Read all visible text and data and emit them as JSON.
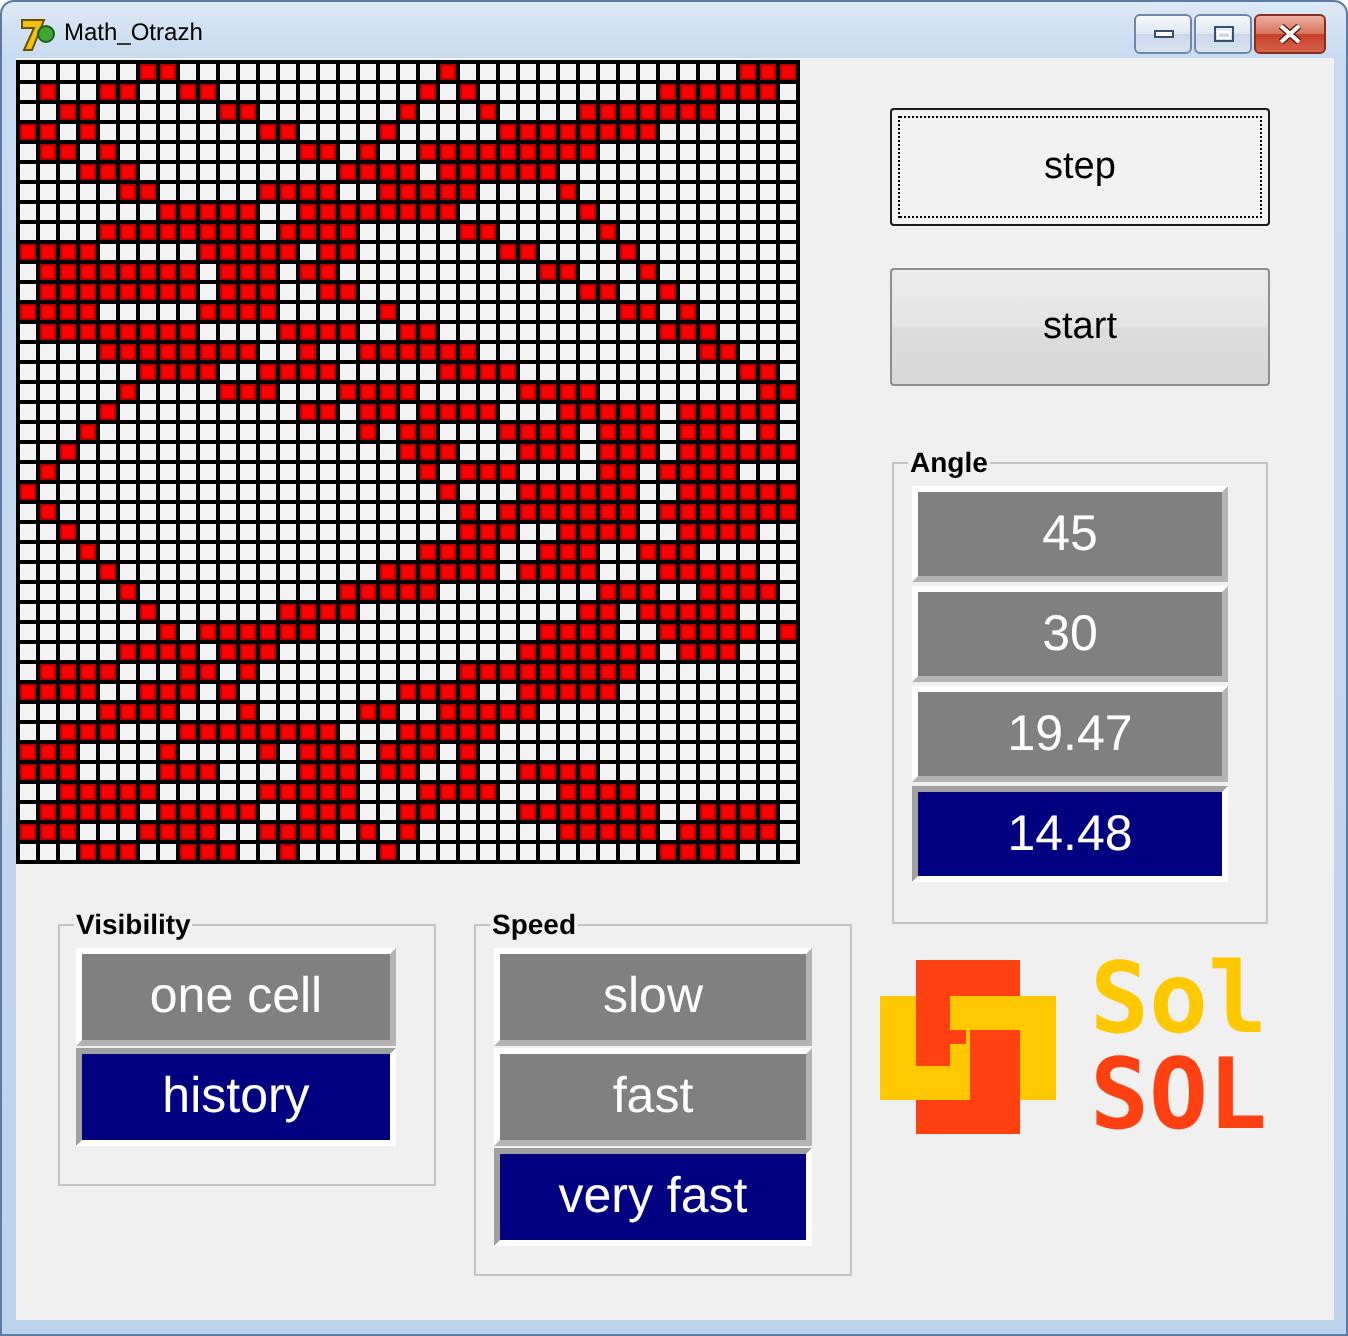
{
  "window": {
    "title": "Math_Otrazh"
  },
  "board": {
    "cells": [
      [
        false,
        false,
        false,
        false,
        false,
        false,
        true,
        true,
        false,
        false,
        false,
        false,
        false,
        false,
        false,
        false,
        false,
        false,
        false,
        false,
        false,
        true,
        false,
        false,
        false,
        false,
        false,
        false,
        false,
        false,
        false,
        false,
        false,
        false,
        false,
        false,
        true,
        true,
        true
      ],
      [
        false,
        true,
        false,
        false,
        true,
        true,
        false,
        false,
        true,
        true,
        false,
        false,
        false,
        false,
        false,
        false,
        false,
        false,
        false,
        false,
        true,
        false,
        true,
        false,
        false,
        false,
        false,
        false,
        false,
        false,
        false,
        false,
        true,
        true,
        true,
        true,
        true,
        true,
        false
      ],
      [
        false,
        false,
        true,
        true,
        false,
        false,
        false,
        false,
        false,
        false,
        true,
        true,
        false,
        false,
        false,
        false,
        false,
        false,
        false,
        true,
        false,
        false,
        false,
        true,
        false,
        false,
        false,
        false,
        true,
        true,
        true,
        true,
        true,
        true,
        true,
        false,
        false,
        false,
        false
      ],
      [
        true,
        true,
        false,
        true,
        false,
        false,
        false,
        false,
        false,
        false,
        false,
        false,
        true,
        true,
        false,
        false,
        false,
        false,
        true,
        false,
        false,
        false,
        false,
        false,
        true,
        true,
        true,
        true,
        true,
        true,
        true,
        true,
        false,
        false,
        false,
        false,
        false,
        false,
        false
      ],
      [
        false,
        true,
        true,
        false,
        true,
        false,
        false,
        false,
        false,
        false,
        false,
        false,
        false,
        false,
        true,
        true,
        false,
        true,
        false,
        false,
        true,
        true,
        true,
        true,
        true,
        true,
        true,
        true,
        true,
        false,
        false,
        false,
        false,
        false,
        false,
        false,
        false,
        false,
        false
      ],
      [
        false,
        false,
        false,
        true,
        true,
        true,
        false,
        false,
        false,
        false,
        false,
        false,
        false,
        false,
        false,
        false,
        true,
        true,
        true,
        true,
        false,
        true,
        true,
        true,
        true,
        true,
        true,
        false,
        false,
        false,
        false,
        false,
        false,
        false,
        false,
        false,
        false,
        false,
        false
      ],
      [
        false,
        false,
        false,
        false,
        false,
        true,
        true,
        false,
        false,
        false,
        false,
        false,
        true,
        true,
        true,
        true,
        false,
        false,
        true,
        true,
        true,
        true,
        true,
        false,
        false,
        false,
        false,
        true,
        false,
        false,
        false,
        false,
        false,
        false,
        false,
        false,
        false,
        false,
        false
      ],
      [
        false,
        false,
        false,
        false,
        false,
        false,
        false,
        true,
        true,
        true,
        true,
        true,
        false,
        false,
        true,
        true,
        true,
        true,
        true,
        true,
        true,
        true,
        false,
        false,
        false,
        false,
        false,
        false,
        true,
        false,
        false,
        false,
        false,
        false,
        false,
        false,
        false,
        false,
        false
      ],
      [
        false,
        false,
        false,
        false,
        true,
        true,
        true,
        true,
        true,
        true,
        true,
        true,
        false,
        true,
        true,
        true,
        true,
        false,
        false,
        false,
        false,
        false,
        true,
        true,
        false,
        false,
        false,
        false,
        false,
        true,
        false,
        false,
        false,
        false,
        false,
        false,
        false,
        false,
        false
      ],
      [
        true,
        true,
        true,
        true,
        false,
        false,
        false,
        false,
        false,
        true,
        true,
        true,
        true,
        true,
        false,
        true,
        true,
        false,
        false,
        false,
        false,
        false,
        false,
        false,
        true,
        true,
        false,
        false,
        false,
        false,
        true,
        false,
        false,
        false,
        false,
        false,
        false,
        false,
        false
      ],
      [
        false,
        true,
        true,
        true,
        true,
        true,
        true,
        true,
        true,
        false,
        true,
        true,
        true,
        false,
        true,
        true,
        false,
        false,
        false,
        false,
        false,
        false,
        false,
        false,
        false,
        false,
        true,
        true,
        false,
        false,
        false,
        true,
        false,
        false,
        false,
        false,
        false,
        false,
        false
      ],
      [
        false,
        true,
        true,
        true,
        true,
        true,
        true,
        true,
        true,
        false,
        true,
        true,
        true,
        false,
        false,
        true,
        true,
        false,
        false,
        false,
        false,
        false,
        false,
        false,
        false,
        false,
        false,
        false,
        true,
        true,
        false,
        false,
        true,
        false,
        false,
        false,
        false,
        false,
        false
      ],
      [
        true,
        true,
        true,
        true,
        false,
        false,
        false,
        false,
        false,
        true,
        true,
        true,
        true,
        false,
        false,
        false,
        false,
        false,
        true,
        false,
        false,
        false,
        false,
        false,
        false,
        false,
        false,
        false,
        false,
        false,
        true,
        true,
        false,
        true,
        false,
        false,
        false,
        false,
        false
      ],
      [
        false,
        true,
        true,
        true,
        true,
        true,
        true,
        true,
        true,
        false,
        false,
        false,
        false,
        true,
        true,
        true,
        true,
        false,
        false,
        true,
        true,
        false,
        false,
        false,
        false,
        false,
        false,
        false,
        false,
        false,
        false,
        false,
        true,
        true,
        true,
        false,
        false,
        false,
        false
      ],
      [
        false,
        false,
        false,
        false,
        true,
        true,
        true,
        true,
        true,
        true,
        true,
        true,
        false,
        false,
        true,
        false,
        false,
        true,
        true,
        true,
        true,
        true,
        true,
        false,
        false,
        false,
        false,
        false,
        false,
        false,
        false,
        false,
        false,
        false,
        true,
        true,
        false,
        false,
        false
      ],
      [
        false,
        false,
        false,
        false,
        false,
        false,
        true,
        true,
        true,
        true,
        false,
        false,
        true,
        true,
        true,
        true,
        false,
        false,
        false,
        false,
        false,
        true,
        true,
        true,
        true,
        false,
        false,
        false,
        false,
        false,
        false,
        false,
        false,
        false,
        false,
        false,
        true,
        true,
        false
      ],
      [
        false,
        false,
        false,
        false,
        false,
        true,
        false,
        false,
        false,
        false,
        true,
        true,
        true,
        false,
        false,
        false,
        true,
        true,
        true,
        true,
        false,
        false,
        false,
        false,
        false,
        true,
        true,
        true,
        true,
        false,
        false,
        false,
        false,
        false,
        false,
        false,
        false,
        true,
        true
      ],
      [
        false,
        false,
        false,
        false,
        true,
        false,
        false,
        false,
        false,
        false,
        false,
        false,
        false,
        false,
        true,
        true,
        false,
        true,
        true,
        false,
        true,
        true,
        true,
        true,
        false,
        false,
        false,
        true,
        true,
        true,
        true,
        true,
        false,
        true,
        true,
        true,
        true,
        true,
        false
      ],
      [
        false,
        false,
        false,
        true,
        false,
        false,
        false,
        false,
        false,
        false,
        false,
        false,
        false,
        false,
        false,
        false,
        false,
        true,
        false,
        true,
        true,
        false,
        false,
        false,
        true,
        true,
        true,
        true,
        false,
        true,
        true,
        true,
        false,
        true,
        true,
        true,
        false,
        true,
        false
      ],
      [
        false,
        false,
        true,
        false,
        false,
        false,
        false,
        false,
        false,
        false,
        false,
        false,
        false,
        false,
        false,
        false,
        false,
        false,
        false,
        true,
        true,
        true,
        false,
        false,
        false,
        true,
        true,
        true,
        false,
        true,
        true,
        true,
        false,
        true,
        true,
        true,
        true,
        true,
        true
      ],
      [
        false,
        true,
        false,
        false,
        false,
        false,
        false,
        false,
        false,
        false,
        false,
        false,
        false,
        false,
        false,
        false,
        false,
        false,
        false,
        false,
        true,
        false,
        true,
        true,
        true,
        false,
        false,
        false,
        false,
        true,
        true,
        false,
        true,
        true,
        true,
        true,
        false,
        false,
        false
      ],
      [
        true,
        false,
        false,
        false,
        false,
        false,
        false,
        false,
        false,
        false,
        false,
        false,
        false,
        false,
        false,
        false,
        false,
        false,
        false,
        false,
        false,
        true,
        false,
        false,
        false,
        true,
        true,
        true,
        true,
        true,
        true,
        false,
        false,
        true,
        true,
        true,
        true,
        true,
        true
      ],
      [
        false,
        true,
        false,
        false,
        false,
        false,
        false,
        false,
        false,
        false,
        false,
        false,
        false,
        false,
        false,
        false,
        false,
        false,
        false,
        false,
        false,
        false,
        true,
        false,
        true,
        true,
        true,
        true,
        true,
        true,
        true,
        false,
        true,
        true,
        true,
        true,
        true,
        true,
        true
      ],
      [
        false,
        false,
        true,
        false,
        false,
        false,
        false,
        false,
        false,
        false,
        false,
        false,
        false,
        false,
        false,
        false,
        false,
        false,
        false,
        false,
        false,
        false,
        true,
        true,
        true,
        false,
        false,
        true,
        true,
        true,
        true,
        false,
        false,
        true,
        true,
        true,
        true,
        false,
        false
      ],
      [
        false,
        false,
        false,
        true,
        false,
        false,
        false,
        false,
        false,
        false,
        false,
        false,
        false,
        false,
        false,
        false,
        false,
        false,
        false,
        false,
        true,
        true,
        true,
        true,
        false,
        false,
        true,
        true,
        true,
        false,
        false,
        true,
        true,
        true,
        false,
        false,
        false,
        false,
        false
      ],
      [
        false,
        false,
        false,
        false,
        true,
        false,
        false,
        false,
        false,
        false,
        false,
        false,
        false,
        false,
        false,
        false,
        false,
        false,
        true,
        true,
        true,
        true,
        true,
        true,
        false,
        true,
        true,
        true,
        true,
        false,
        false,
        false,
        true,
        true,
        true,
        true,
        true,
        false,
        false
      ],
      [
        false,
        false,
        false,
        false,
        false,
        true,
        false,
        false,
        false,
        false,
        false,
        false,
        false,
        false,
        false,
        false,
        true,
        true,
        true,
        true,
        true,
        false,
        false,
        false,
        false,
        false,
        false,
        false,
        false,
        true,
        true,
        true,
        false,
        false,
        true,
        true,
        true,
        true,
        false
      ],
      [
        false,
        false,
        false,
        false,
        false,
        false,
        true,
        false,
        false,
        false,
        false,
        false,
        false,
        true,
        true,
        true,
        true,
        false,
        false,
        false,
        false,
        false,
        false,
        false,
        false,
        false,
        false,
        false,
        true,
        true,
        false,
        true,
        true,
        true,
        true,
        true,
        false,
        false,
        false
      ],
      [
        false,
        false,
        false,
        false,
        false,
        false,
        false,
        true,
        false,
        true,
        true,
        true,
        true,
        true,
        true,
        false,
        false,
        false,
        false,
        false,
        false,
        false,
        false,
        false,
        false,
        false,
        true,
        true,
        true,
        true,
        false,
        false,
        true,
        true,
        true,
        true,
        true,
        false,
        true
      ],
      [
        false,
        false,
        false,
        false,
        false,
        true,
        true,
        true,
        true,
        false,
        true,
        true,
        true,
        false,
        false,
        false,
        false,
        false,
        false,
        false,
        false,
        false,
        false,
        false,
        false,
        true,
        true,
        true,
        true,
        true,
        true,
        true,
        false,
        true,
        true,
        true,
        false,
        false,
        false
      ],
      [
        false,
        true,
        true,
        true,
        true,
        false,
        false,
        false,
        true,
        true,
        false,
        true,
        false,
        false,
        false,
        false,
        false,
        false,
        false,
        false,
        false,
        false,
        true,
        true,
        true,
        true,
        true,
        true,
        true,
        true,
        true,
        false,
        false,
        false,
        false,
        false,
        false,
        false,
        false
      ],
      [
        true,
        true,
        true,
        true,
        false,
        false,
        true,
        true,
        true,
        false,
        true,
        false,
        false,
        false,
        false,
        false,
        false,
        false,
        false,
        true,
        true,
        true,
        true,
        false,
        false,
        true,
        true,
        true,
        true,
        true,
        false,
        false,
        false,
        false,
        false,
        false,
        false,
        false,
        false
      ],
      [
        false,
        false,
        false,
        false,
        true,
        true,
        true,
        true,
        false,
        false,
        false,
        true,
        false,
        false,
        false,
        false,
        false,
        true,
        true,
        false,
        false,
        true,
        true,
        true,
        true,
        true,
        false,
        false,
        false,
        false,
        false,
        false,
        false,
        false,
        false,
        false,
        false,
        false,
        false
      ],
      [
        false,
        false,
        true,
        true,
        true,
        false,
        false,
        false,
        true,
        true,
        true,
        true,
        true,
        true,
        true,
        true,
        false,
        false,
        false,
        true,
        true,
        true,
        true,
        true,
        false,
        false,
        false,
        false,
        false,
        false,
        false,
        false,
        false,
        false,
        false,
        false,
        false,
        false,
        false
      ],
      [
        true,
        true,
        true,
        false,
        false,
        false,
        false,
        true,
        false,
        false,
        false,
        false,
        true,
        false,
        true,
        true,
        true,
        false,
        true,
        true,
        true,
        false,
        true,
        false,
        false,
        false,
        false,
        false,
        false,
        false,
        false,
        false,
        false,
        false,
        false,
        false,
        false,
        false,
        false
      ],
      [
        true,
        true,
        true,
        false,
        false,
        false,
        false,
        true,
        true,
        true,
        false,
        false,
        false,
        false,
        true,
        true,
        true,
        false,
        true,
        true,
        false,
        false,
        true,
        false,
        false,
        true,
        true,
        true,
        true,
        false,
        false,
        false,
        false,
        false,
        false,
        false,
        false,
        false,
        false
      ],
      [
        false,
        false,
        true,
        true,
        true,
        true,
        true,
        false,
        false,
        false,
        false,
        false,
        true,
        true,
        true,
        true,
        true,
        false,
        false,
        false,
        true,
        true,
        true,
        true,
        false,
        false,
        false,
        true,
        true,
        true,
        true,
        false,
        false,
        false,
        false,
        false,
        false,
        false,
        false
      ],
      [
        false,
        true,
        true,
        true,
        true,
        true,
        false,
        true,
        true,
        true,
        true,
        true,
        false,
        false,
        true,
        true,
        true,
        false,
        false,
        true,
        true,
        false,
        false,
        false,
        false,
        true,
        true,
        true,
        true,
        true,
        true,
        true,
        false,
        false,
        true,
        true,
        true,
        true,
        false
      ],
      [
        true,
        true,
        true,
        false,
        false,
        false,
        true,
        true,
        true,
        true,
        false,
        false,
        true,
        true,
        true,
        true,
        false,
        true,
        false,
        true,
        false,
        false,
        false,
        false,
        false,
        false,
        false,
        true,
        true,
        true,
        true,
        true,
        false,
        true,
        true,
        true,
        true,
        true,
        false
      ],
      [
        false,
        false,
        false,
        true,
        true,
        true,
        false,
        false,
        true,
        true,
        true,
        false,
        false,
        true,
        false,
        false,
        false,
        false,
        true,
        false,
        false,
        false,
        false,
        false,
        false,
        false,
        false,
        false,
        false,
        false,
        false,
        false,
        true,
        true,
        true,
        true,
        false,
        false,
        false
      ]
    ]
  },
  "actions": [
    {
      "label": "step",
      "focused": true
    },
    {
      "label": "start",
      "focused": false
    }
  ],
  "angle": {
    "label": "Angle",
    "options": [
      {
        "label": "45",
        "selected": false
      },
      {
        "label": "30",
        "selected": false
      },
      {
        "label": "19.47",
        "selected": false
      },
      {
        "label": "14.48",
        "selected": true
      }
    ]
  },
  "visibility": {
    "label": "Visibility",
    "options": [
      {
        "label": "one cell",
        "selected": false
      },
      {
        "label": "history",
        "selected": true
      }
    ]
  },
  "speed": {
    "label": "Speed",
    "options": [
      {
        "label": "slow",
        "selected": false
      },
      {
        "label": "fast",
        "selected": false
      },
      {
        "label": "very fast",
        "selected": true
      }
    ]
  },
  "logo": {
    "lines": [
      {
        "text": "Sol",
        "color": "#ffc800"
      },
      {
        "text": "SOL",
        "color": "#ff4010"
      }
    ]
  }
}
